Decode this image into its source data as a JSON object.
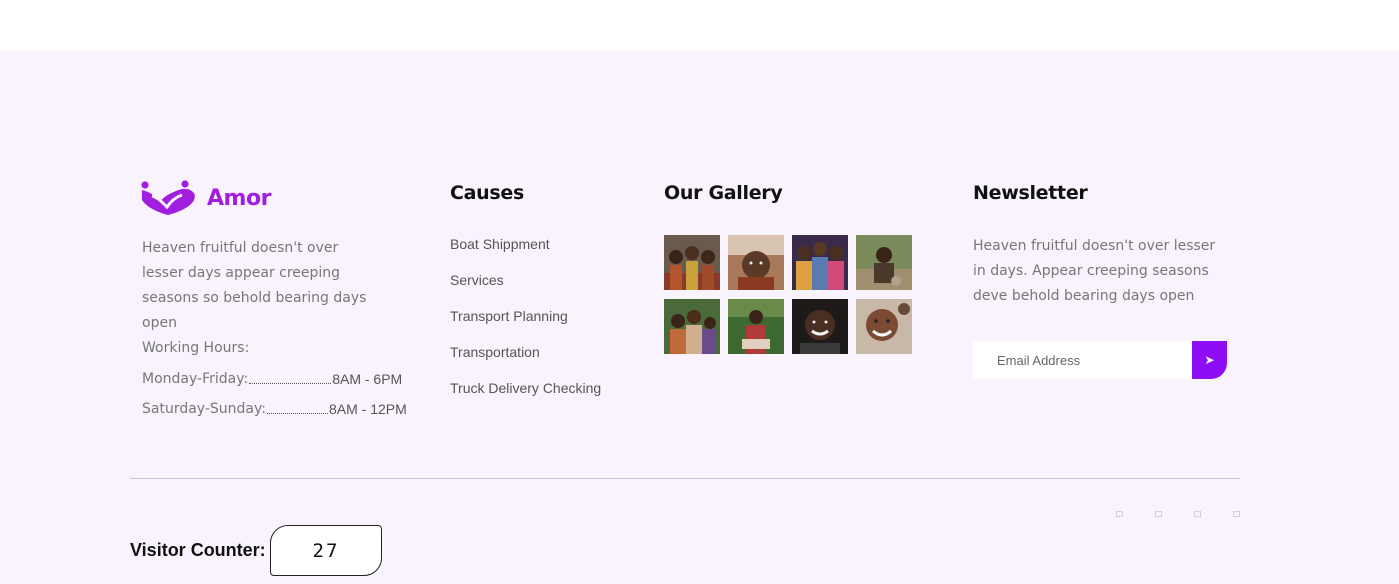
{
  "brand": {
    "name": "Amor",
    "color": "#a11ee0"
  },
  "about": {
    "text": "Heaven fruitful doesn't over lesser days appear creeping seasons so behold bearing days open",
    "hours_title": "Working Hours:",
    "hours": [
      {
        "day": "Monday-Friday:",
        "time": "8AM - 6PM"
      },
      {
        "day": "Saturday-Sunday:",
        "time": "8AM - 12PM"
      }
    ]
  },
  "causes": {
    "heading": "Causes",
    "items": [
      "Boat Shippment",
      "Services",
      "Transport Planning",
      "Transportation",
      "Truck Delivery Checking"
    ]
  },
  "gallery": {
    "heading": "Our Gallery"
  },
  "newsletter": {
    "heading": "Newsletter",
    "text": "Heaven fruitful doesn't over lesser in days. Appear creeping seasons deve behold bearing days open",
    "placeholder": "Email Address",
    "button_icon": "paper-plane-icon",
    "accent": "#8f0df5"
  },
  "social": {
    "icons": [
      "facebook-icon",
      "twitter-icon",
      "instagram-icon",
      "linkedin-icon"
    ]
  },
  "visitor": {
    "label": "Visitor Counter:",
    "count": "27"
  },
  "colors": {
    "footer_bg": "#f8f3fc",
    "accent": "#8f0df5"
  }
}
